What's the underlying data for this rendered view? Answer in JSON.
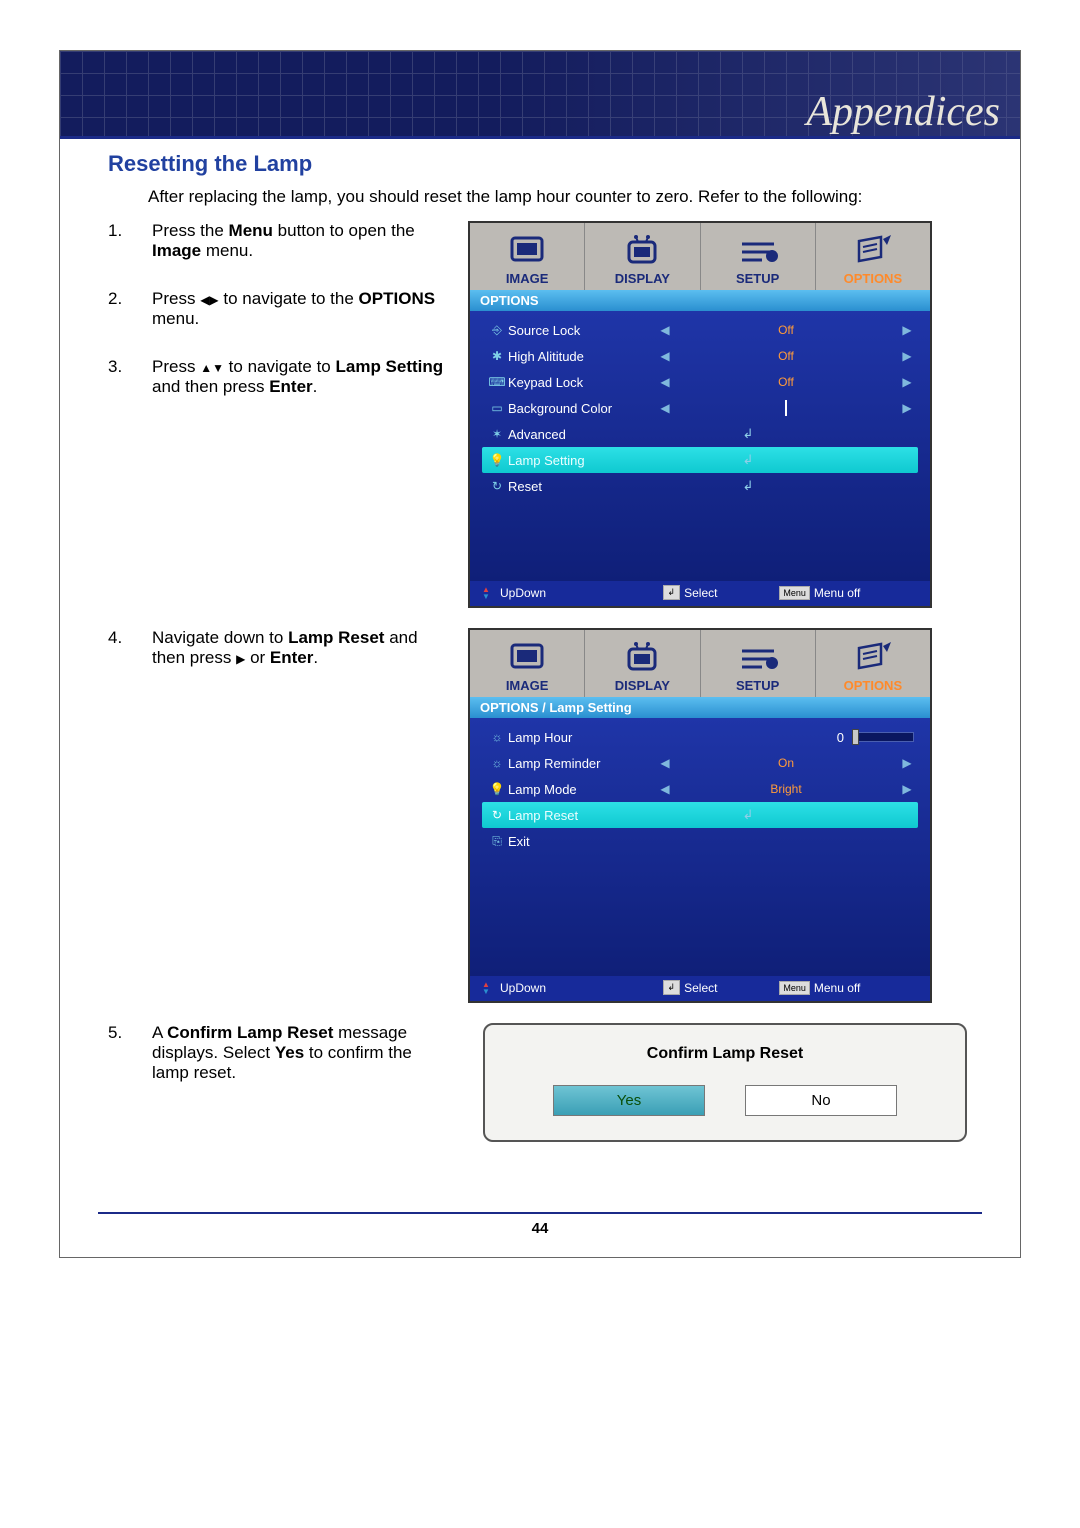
{
  "header": {
    "title": "Appendices"
  },
  "section": {
    "title": "Resetting the Lamp",
    "intro": "After replacing the lamp, you should reset the lamp hour counter to zero. Refer to the following:"
  },
  "steps": {
    "s1": {
      "num": "1.",
      "a": "Press the ",
      "b": "Menu",
      "c": " button to open the ",
      "d": "Image",
      "e": " menu."
    },
    "s2": {
      "num": "2.",
      "a": "Press  ",
      "b": " to navigate to the ",
      "c": "OPTIONS",
      "d": " menu."
    },
    "s3": {
      "num": "3.",
      "a": "Press ",
      "b": " to navigate to ",
      "c": "Lamp Setting",
      "d": " and then press ",
      "e": "Enter",
      "f": "."
    },
    "s4": {
      "num": "4.",
      "a": "Navigate down to ",
      "b": "Lamp Reset",
      "c": " and then press ",
      "d": " or ",
      "e": "Enter",
      "f": "."
    },
    "s5": {
      "num": "5.",
      "a": "A ",
      "b": "Confirm Lamp Reset",
      "c": " message displays. Select ",
      "d": "Yes",
      "e": " to confirm the lamp reset."
    }
  },
  "tabs": {
    "image": "IMAGE",
    "display": "DISPLAY",
    "setup": "SETUP",
    "options": "OPTIONS"
  },
  "osd1": {
    "breadcrumb": "OPTIONS",
    "items": {
      "source_lock": {
        "label": "Source Lock",
        "value": "Off"
      },
      "high_altitude": {
        "label": "High Alititude",
        "value": "Off"
      },
      "keypad_lock": {
        "label": "Keypad Lock",
        "value": "Off"
      },
      "background_color": {
        "label": "Background Color"
      },
      "advanced": {
        "label": "Advanced"
      },
      "lamp_setting": {
        "label": "Lamp Setting"
      },
      "reset": {
        "label": "Reset"
      }
    }
  },
  "osd2": {
    "breadcrumb": "OPTIONS / Lamp Setting",
    "items": {
      "lamp_hour": {
        "label": "Lamp Hour",
        "value": "0"
      },
      "lamp_reminder": {
        "label": "Lamp Reminder",
        "value": "On"
      },
      "lamp_mode": {
        "label": "Lamp Mode",
        "value": "Bright"
      },
      "lamp_reset": {
        "label": "Lamp Reset"
      },
      "exit": {
        "label": "Exit"
      }
    }
  },
  "footer": {
    "updown": "UpDown",
    "select": "Select",
    "menuoff": "Menu off"
  },
  "confirm": {
    "title": "Confirm Lamp Reset",
    "yes": "Yes",
    "no": "No"
  },
  "page_number": "44"
}
